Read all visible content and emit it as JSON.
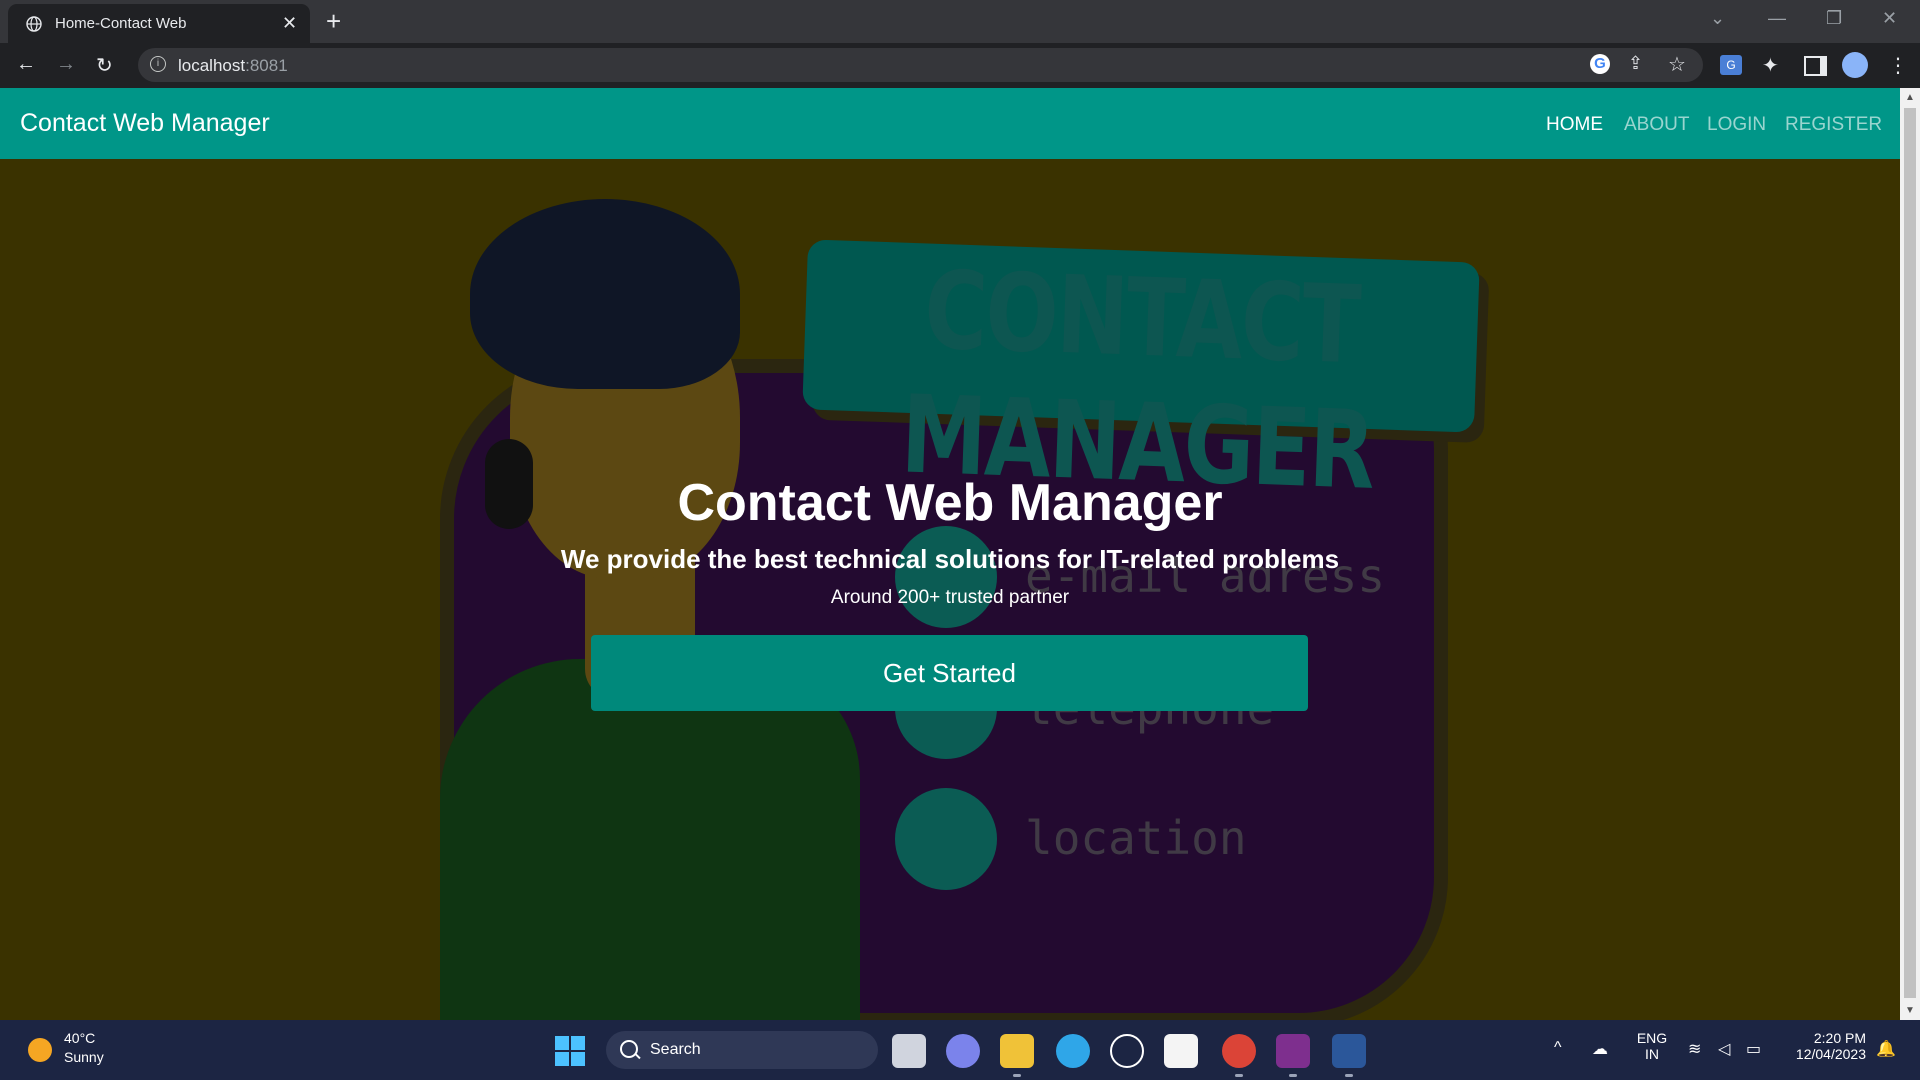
{
  "browser": {
    "tab_title": "Home-Contact Web",
    "new_tab_label": "+",
    "close_tab_label": "✕",
    "url_host": "localhost",
    "url_port": ":8081"
  },
  "navbar": {
    "brand": "Contact Web Manager",
    "links": [
      "HOME",
      "ABOUT",
      "LOGIN",
      "REGISTER"
    ],
    "active": "HOME"
  },
  "hero": {
    "banner_text": "CONTACT MANAGER",
    "contact_labels": [
      "e-mail adress",
      "telephone",
      "location"
    ],
    "title": "Contact Web Manager",
    "subtitle": "We provide the best technical solutions for IT-related problems",
    "note": "Around 200+ trusted partner",
    "cta": "Get Started"
  },
  "taskbar": {
    "temperature": "40°C",
    "condition": "Sunny",
    "search_label": "Search",
    "lang": "ENG",
    "region": "IN",
    "time": "2:20 PM",
    "date": "12/04/2023"
  },
  "colors": {
    "primary": "#009688",
    "button": "#00897b",
    "taskbar": "#1c2543"
  }
}
